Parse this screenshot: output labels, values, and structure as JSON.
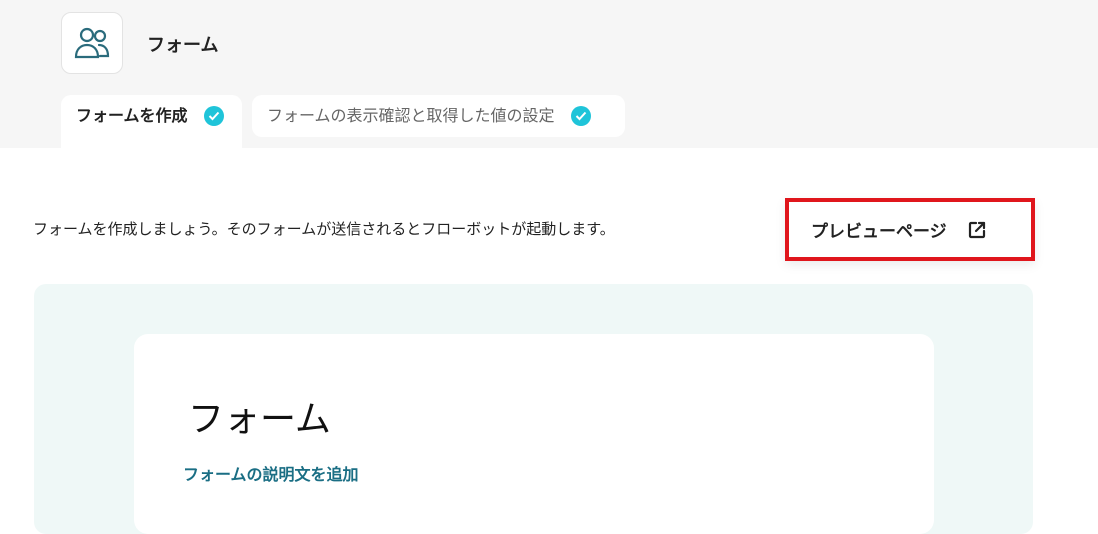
{
  "app": {
    "title": "フォーム",
    "icon": "users-icon"
  },
  "tabs": [
    {
      "label": "フォームを作成",
      "status": "complete",
      "active": true
    },
    {
      "label": "フォームの表示確認と取得した値の設定",
      "status": "complete",
      "active": false
    }
  ],
  "content": {
    "intro_text": "フォームを作成しましょう。そのフォームが送信されるとフローボットが起動します。",
    "preview_button": {
      "label": "プレビューページ",
      "icon": "external-link-icon"
    }
  },
  "form_preview": {
    "title": "フォーム",
    "add_description_link": "フォームの説明文を追加"
  },
  "colors": {
    "accent_check": "#1fc4d9",
    "highlight_border": "#e0161c",
    "link": "#1a6e84",
    "icon_stroke": "#2a6b7c",
    "canvas_bg": "#eff8f7"
  }
}
